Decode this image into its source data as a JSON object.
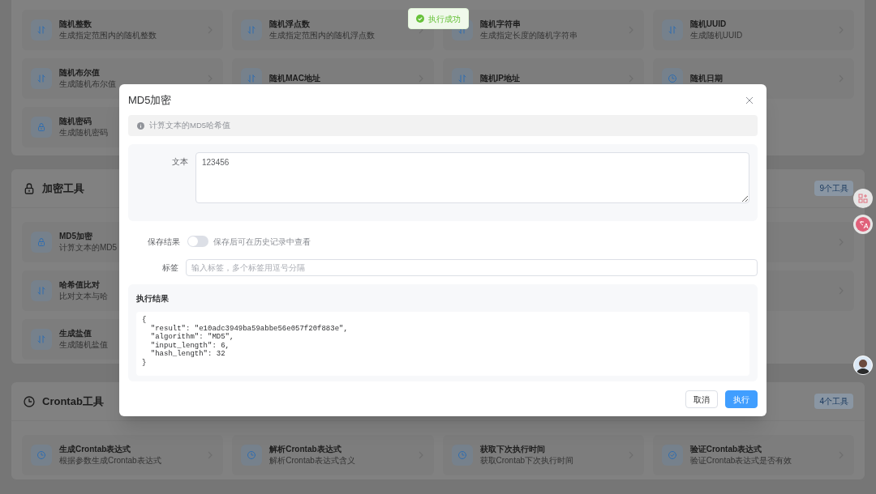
{
  "toast": {
    "text": "执行成功"
  },
  "sections": [
    {
      "cards": [
        {
          "kind": "random",
          "title": "随机整数",
          "description": "生成指定范围内的随机整数"
        },
        {
          "kind": "random",
          "title": "随机浮点数",
          "description": "生成指定范围内的随机浮点数"
        },
        {
          "kind": "random",
          "title": "随机字符串",
          "description": "生成指定长度的随机字符串"
        },
        {
          "kind": "random",
          "title": "随机UUID",
          "description": "生成随机UUID"
        },
        {
          "kind": "random",
          "title": "随机布尔值",
          "description": "生成随机布尔值"
        },
        {
          "kind": "random",
          "title": "随机MAC地址"
        },
        {
          "kind": "random",
          "title": "随机IP地址"
        },
        {
          "kind": "time",
          "title": "随机日期"
        },
        {
          "kind": "secure",
          "title": "随机密码",
          "description": "生成随机密码"
        }
      ]
    },
    {
      "title": "加密工具",
      "kind": "secure",
      "badge": "9个工具",
      "cards": [
        {
          "kind": "secure",
          "title": "MD5加密",
          "description": "计算文本的MD5"
        },
        {
          "kind": "covered"
        },
        {
          "kind": "covered"
        },
        {
          "kind": "edge"
        },
        {
          "kind": "random",
          "title": "哈希值比对",
          "description": "比对文本与哈"
        },
        {
          "kind": "covered"
        },
        {
          "kind": "covered"
        },
        {
          "kind": "edge"
        },
        {
          "kind": "random",
          "title": "生成盐值",
          "description": "生成随机盐值"
        }
      ]
    },
    {
      "title": "Crontab工具",
      "kind": "time",
      "badge": "4个工具",
      "cards": [
        {
          "kind": "time",
          "title": "生成Crontab表达式",
          "description": "根据参数生成Crontab表达式"
        },
        {
          "kind": "time",
          "title": "解析Crontab表达式",
          "description": "解析Crontab表达式含义"
        },
        {
          "kind": "time",
          "title": "获取下次执行时间",
          "description": "获取Crontab下次执行时间"
        },
        {
          "kind": "validate",
          "title": "验证Crontab表达式",
          "description": "验证Crontab表达式是否有效"
        }
      ]
    }
  ],
  "dialog": {
    "title": "MD5加密",
    "info": "计算文本的MD5哈希值",
    "text_field": {
      "label": "文本",
      "value": "123456"
    },
    "save_result": {
      "label": "保存结果",
      "on": false,
      "hint": "保存后可在历史记录中查看"
    },
    "tags_field": {
      "label": "标签",
      "placeholder": "输入标签，多个标签用逗号分隔"
    },
    "result": {
      "title": "执行结果",
      "code": "{\n  \"result\": \"e10adc3949ba59abbe56e057f20f883e\",\n  \"algorithm\": \"MD5\",\n  \"input_length\": 6,\n  \"hash_length\": 32\n}"
    },
    "buttons": [
      {
        "kind": "secondary",
        "label": "取消"
      },
      {
        "kind": "primary",
        "label": "执行"
      }
    ]
  }
}
